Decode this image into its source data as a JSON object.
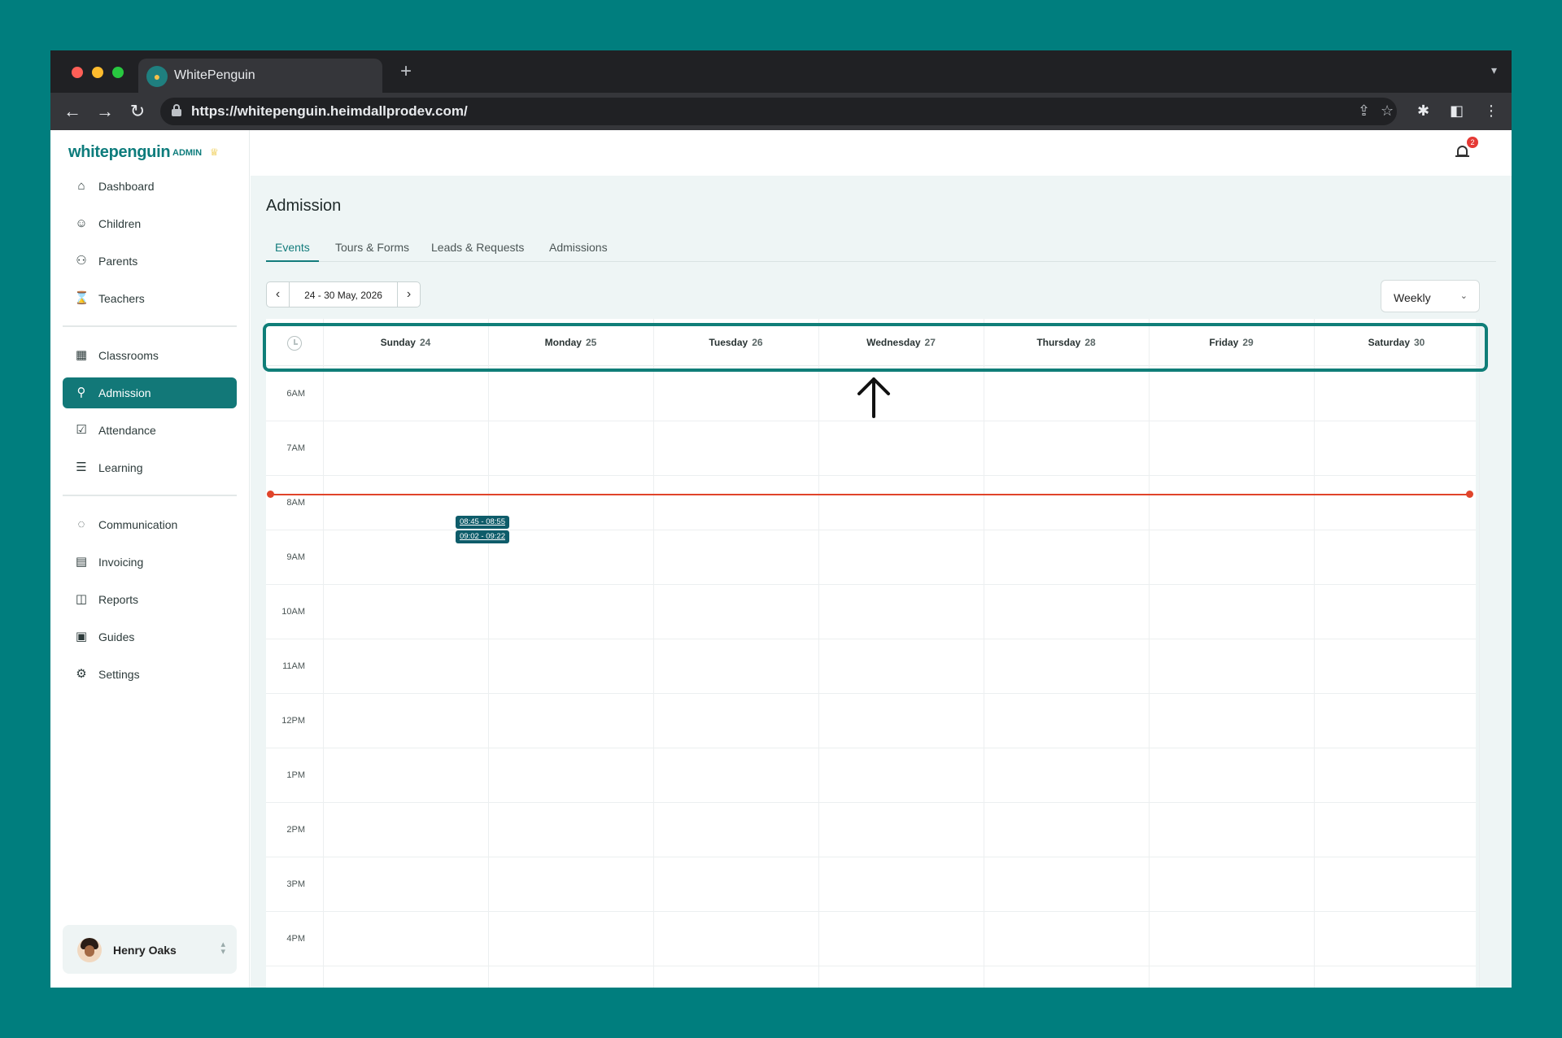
{
  "browser": {
    "tab_title": "WhitePenguin",
    "url": "https://whitepenguin.heimdallprodev.com/",
    "traffic_colors": [
      "#ff5f57",
      "#febc2e",
      "#28c840"
    ]
  },
  "sidebar": {
    "logo": "whitepenguin",
    "logo_badge": "ADMIN",
    "items": [
      {
        "label": "Dashboard",
        "icon": "home-icon"
      },
      {
        "label": "Children",
        "icon": "child-icon"
      },
      {
        "label": "Parents",
        "icon": "parents-icon"
      },
      {
        "label": "Teachers",
        "icon": "teacher-icon"
      },
      {
        "label": "Classrooms",
        "icon": "grid-icon"
      },
      {
        "label": "Admission",
        "icon": "user-plus-icon",
        "active": true
      },
      {
        "label": "Attendance",
        "icon": "check-square-icon"
      },
      {
        "label": "Learning",
        "icon": "learning-icon"
      },
      {
        "label": "Communication",
        "icon": "chat-icon"
      },
      {
        "label": "Invoicing",
        "icon": "invoice-icon"
      },
      {
        "label": "Reports",
        "icon": "chart-icon"
      },
      {
        "label": "Guides",
        "icon": "book-icon"
      },
      {
        "label": "Settings",
        "icon": "gear-icon"
      }
    ],
    "user_name": "Henry Oaks"
  },
  "header": {
    "notification_count": "2"
  },
  "page": {
    "title": "Admission",
    "tabs": [
      "Events",
      "Tours & Forms",
      "Leads & Requests",
      "Admissions"
    ],
    "active_tab": "Events",
    "date_range": "24 - 30 May, 2026",
    "view": "Weekly"
  },
  "calendar": {
    "days": [
      {
        "name": "Sunday",
        "num": "24"
      },
      {
        "name": "Monday",
        "num": "25"
      },
      {
        "name": "Tuesday",
        "num": "26"
      },
      {
        "name": "Wednesday",
        "num": "27"
      },
      {
        "name": "Thursday",
        "num": "28"
      },
      {
        "name": "Friday",
        "num": "29"
      },
      {
        "name": "Saturday",
        "num": "30"
      }
    ],
    "hours": [
      "6AM",
      "7AM",
      "8AM",
      "9AM",
      "10AM",
      "11AM",
      "12PM",
      "1PM",
      "2PM",
      "3PM",
      "4PM"
    ],
    "events": [
      {
        "label": "08:45 - 08:55",
        "day": "Monday"
      },
      {
        "label": "09:02 - 09:22",
        "day": "Monday"
      }
    ]
  },
  "colors": {
    "accent": "#127878",
    "now_line": "#e0442a",
    "event": "#0e5c6a",
    "background": "#007e7e"
  }
}
